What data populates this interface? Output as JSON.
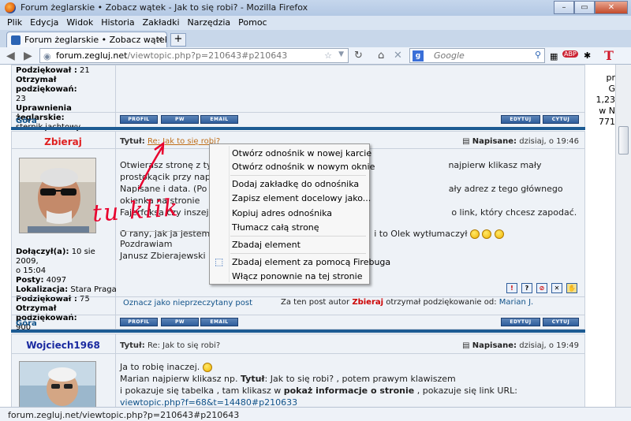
{
  "window": {
    "title": "Forum żeglarskie • Zobacz wątek - Jak to się robi? - Mozilla Firefox",
    "btn_min": "–",
    "btn_max": "▭",
    "btn_close": "✕"
  },
  "menubar": [
    "Plik",
    "Edycja",
    "Widok",
    "Historia",
    "Zakładki",
    "Narzędzia",
    "Pomoc"
  ],
  "tab": {
    "label": "Forum żeglarskie • Zobacz wątek - Jak to...",
    "close": "×",
    "new": "+"
  },
  "nav": {
    "url_domain": "forum.zegluj.net",
    "url_path": "/viewtopic.php?p=210643#p210643",
    "search_placeholder": "Google",
    "search_engine_letter": "g"
  },
  "addons": {
    "abp": "ABP",
    "t": "T"
  },
  "right_overflow": [
    "pr",
    "G",
    "1,23",
    "w N",
    "771"
  ],
  "prev_post": {
    "lines": [
      {
        "label": "Podziękował :",
        "value": "21"
      },
      {
        "label": "Otrzymał podziękowań:",
        "value": ""
      },
      {
        "label": "",
        "value": "23"
      },
      {
        "label": "Uprawnienia żeglarskie:",
        "value": ""
      },
      {
        "label": "",
        "value": "sternik jachtowy"
      }
    ],
    "gora": "Góra"
  },
  "buttons": {
    "profil": "PROFIL",
    "pw": "PW",
    "email": "EMAIL",
    "edytuj": "EDYTUJ",
    "cytuj": "CYTUJ"
  },
  "post1": {
    "author": "Zbieraj",
    "author_color": "#e02020",
    "title_label": "Tytuł:",
    "title_link": "Re: Jak to się robi?",
    "date_label": "Napisane:",
    "date_value": "dzisiaj, o 19:46",
    "body_l1_a": "Otwierasz stronę z ty",
    "body_l1_b": "najpierw klikasz mały prostokącik przy napisie:",
    "body_l2_a": "Napisane i data. (Po p",
    "body_l2_b": "ały adrez z tego głównego okienka na stronie",
    "body_l3_a": "Fajerfoksa czy inszej (",
    "body_l3_b": "o link, który chcesz zapodać.",
    "body_l4_a": "O rany, jak ja jestem",
    "body_l4_b": "i to Olek wytłumaczył",
    "sig1": "Pozdrawiam",
    "sig2": "Janusz Zbierajewski",
    "joined_label": "Dołączył(a):",
    "joined_value": "10 sie 2009,",
    "joined_value2": "o 15:04",
    "posts_label": "Posty:",
    "posts_value": "4097",
    "loc_label": "Lokalizacja:",
    "loc_value": "Stara Praga",
    "thanked_label": "Podziękował :",
    "thanked_value": "75",
    "received_label": "Otrzymał podziękowań:",
    "received_value": "900",
    "mark_unread": "Oznacz jako nieprzeczytany post",
    "thanks_pre": "Za ten post autor",
    "thanks_author": "Zbieraj",
    "thanks_mid": "otrzymał podziękowanie od:",
    "thanks_by": "Marian J.",
    "gora": "Góra"
  },
  "post2": {
    "author": "Wojciech1968",
    "author_color": "#1a2aa0",
    "title_label": "Tytuł:",
    "title_text": "Re: Jak to się robi?",
    "date_label": "Napisane:",
    "date_value": "dzisiaj, o 19:49",
    "l1": "Ja to robię inaczej.",
    "l2_a": "Marian najpierw klikasz np.",
    "l2_b": "Tytuł",
    "l2_c": ": Jak to się robi? , potem prawym klawiszem",
    "l3_a": "i pokazuje się tabelka , tam klikasz w",
    "l3_b": "pokaż informacje o stronie",
    "l3_c": ", pokazuje się link URL:",
    "l4": "viewtopic.php?f=68&t=14480#p210633"
  },
  "context_menu": {
    "items": [
      "Otwórz odnośnik w nowej karcie",
      "Otwórz odnośnik w nowym oknie",
      "Dodaj zakładkę do odnośnika",
      "Zapisz element docelowy jako...",
      "Kopiuj adres odnośnika",
      "Tłumacz całą stronę",
      "Zbadaj element",
      "Zbadaj element za pomocą Firebuga",
      "Włącz ponownie na tej stronie"
    ]
  },
  "annotation": "tu klik",
  "annotation_color": "#e8002d",
  "status_url": "forum.zegluj.net/viewtopic.php?p=210643#p210643"
}
